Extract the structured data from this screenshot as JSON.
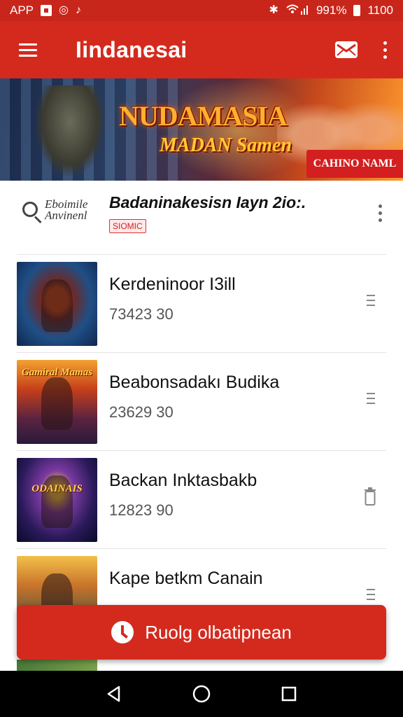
{
  "status_bar": {
    "left_label": "APP",
    "battery": "991%",
    "time": "1100"
  },
  "app_bar": {
    "title": "Iindanesai",
    "mail_icon": "mail-icon",
    "menu_icon": "hamburger-menu-icon",
    "more_icon": "more-vert-icon"
  },
  "banner": {
    "title": "NUDAMASIA",
    "subtitle": "MADAN Samen",
    "cta": "CAHINO NAML"
  },
  "featured": {
    "logo_text": "Eboimile Anvinenl",
    "title": "Badaninakesisn Iayn 2io:.",
    "badge": "SIOMIC"
  },
  "items": [
    {
      "title": "Kerdeninoor I3ill",
      "subtitle": "73423 30",
      "thumb_label": "",
      "icon": "drag-lines-icon"
    },
    {
      "title": "Beabonsadakı Budika",
      "subtitle": "23629 30",
      "thumb_label": "Gamiral Mamas",
      "icon": "drag-lines-icon"
    },
    {
      "title": "Backan Inktasbakb",
      "subtitle": "12823 90",
      "thumb_label": "ODAINAIS",
      "icon": "trash-icon"
    },
    {
      "title": "Kape betkm Canain",
      "subtitle": "",
      "thumb_label": "",
      "icon": "drag-lines-icon"
    }
  ],
  "fab": {
    "label": "Ruolg olbatipnean",
    "icon": "clock-icon"
  },
  "nav": {
    "back_icon": "back-triangle-icon",
    "home_icon": "home-circle-icon",
    "recents_icon": "recents-square-icon"
  },
  "colors": {
    "primary": "#d42a1e",
    "status_bar": "#c9261b",
    "badge_text": "#cc2222"
  }
}
